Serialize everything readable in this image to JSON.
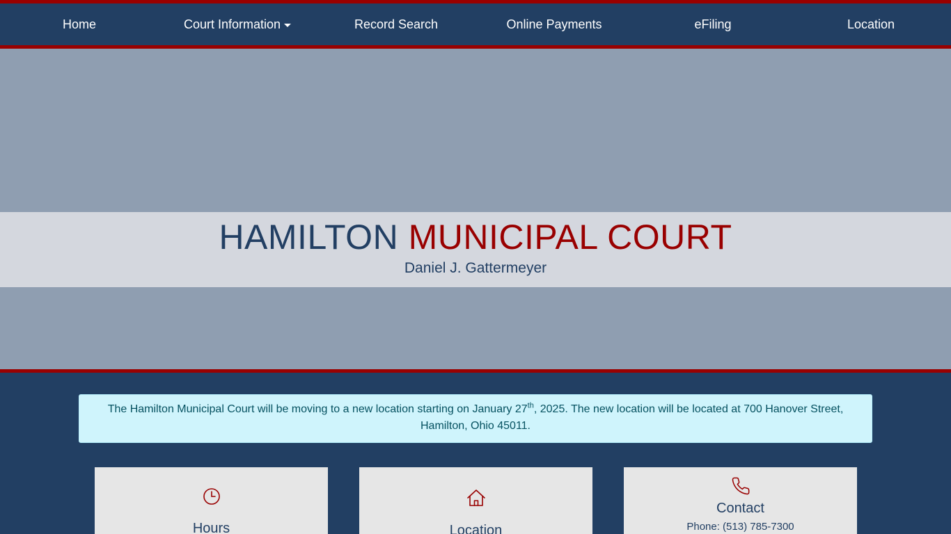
{
  "nav": {
    "items": [
      {
        "label": "Home"
      },
      {
        "label": "Court Information",
        "has_dropdown": true
      },
      {
        "label": "Record Search"
      },
      {
        "label": "Online Payments"
      },
      {
        "label": "eFiling"
      },
      {
        "label": "Location"
      }
    ]
  },
  "hero": {
    "title_part1": "HAMILTON",
    "title_part2": "MUNICIPAL COURT",
    "subtitle": "Daniel J. Gattermeyer"
  },
  "alert": {
    "text_before_sup": "The Hamilton Municipal Court will be moving to a new location starting on January 27",
    "sup": "th",
    "text_after_sup": ", 2025. The new location will be located at 700 Hanover Street, Hamilton, Ohio 45011."
  },
  "cards": [
    {
      "icon": "clock-icon",
      "title": "Hours"
    },
    {
      "icon": "home-icon",
      "title": "Location"
    },
    {
      "icon": "phone-icon",
      "title": "Contact",
      "text": "Phone: (513) 785-7300"
    }
  ],
  "colors": {
    "navy": "#223f63",
    "red": "#990000",
    "hero_bg": "#8f9eb1",
    "hero_band": "#d4d7de",
    "alert_bg": "#cff4fc",
    "card_bg": "#e6e6e6"
  }
}
